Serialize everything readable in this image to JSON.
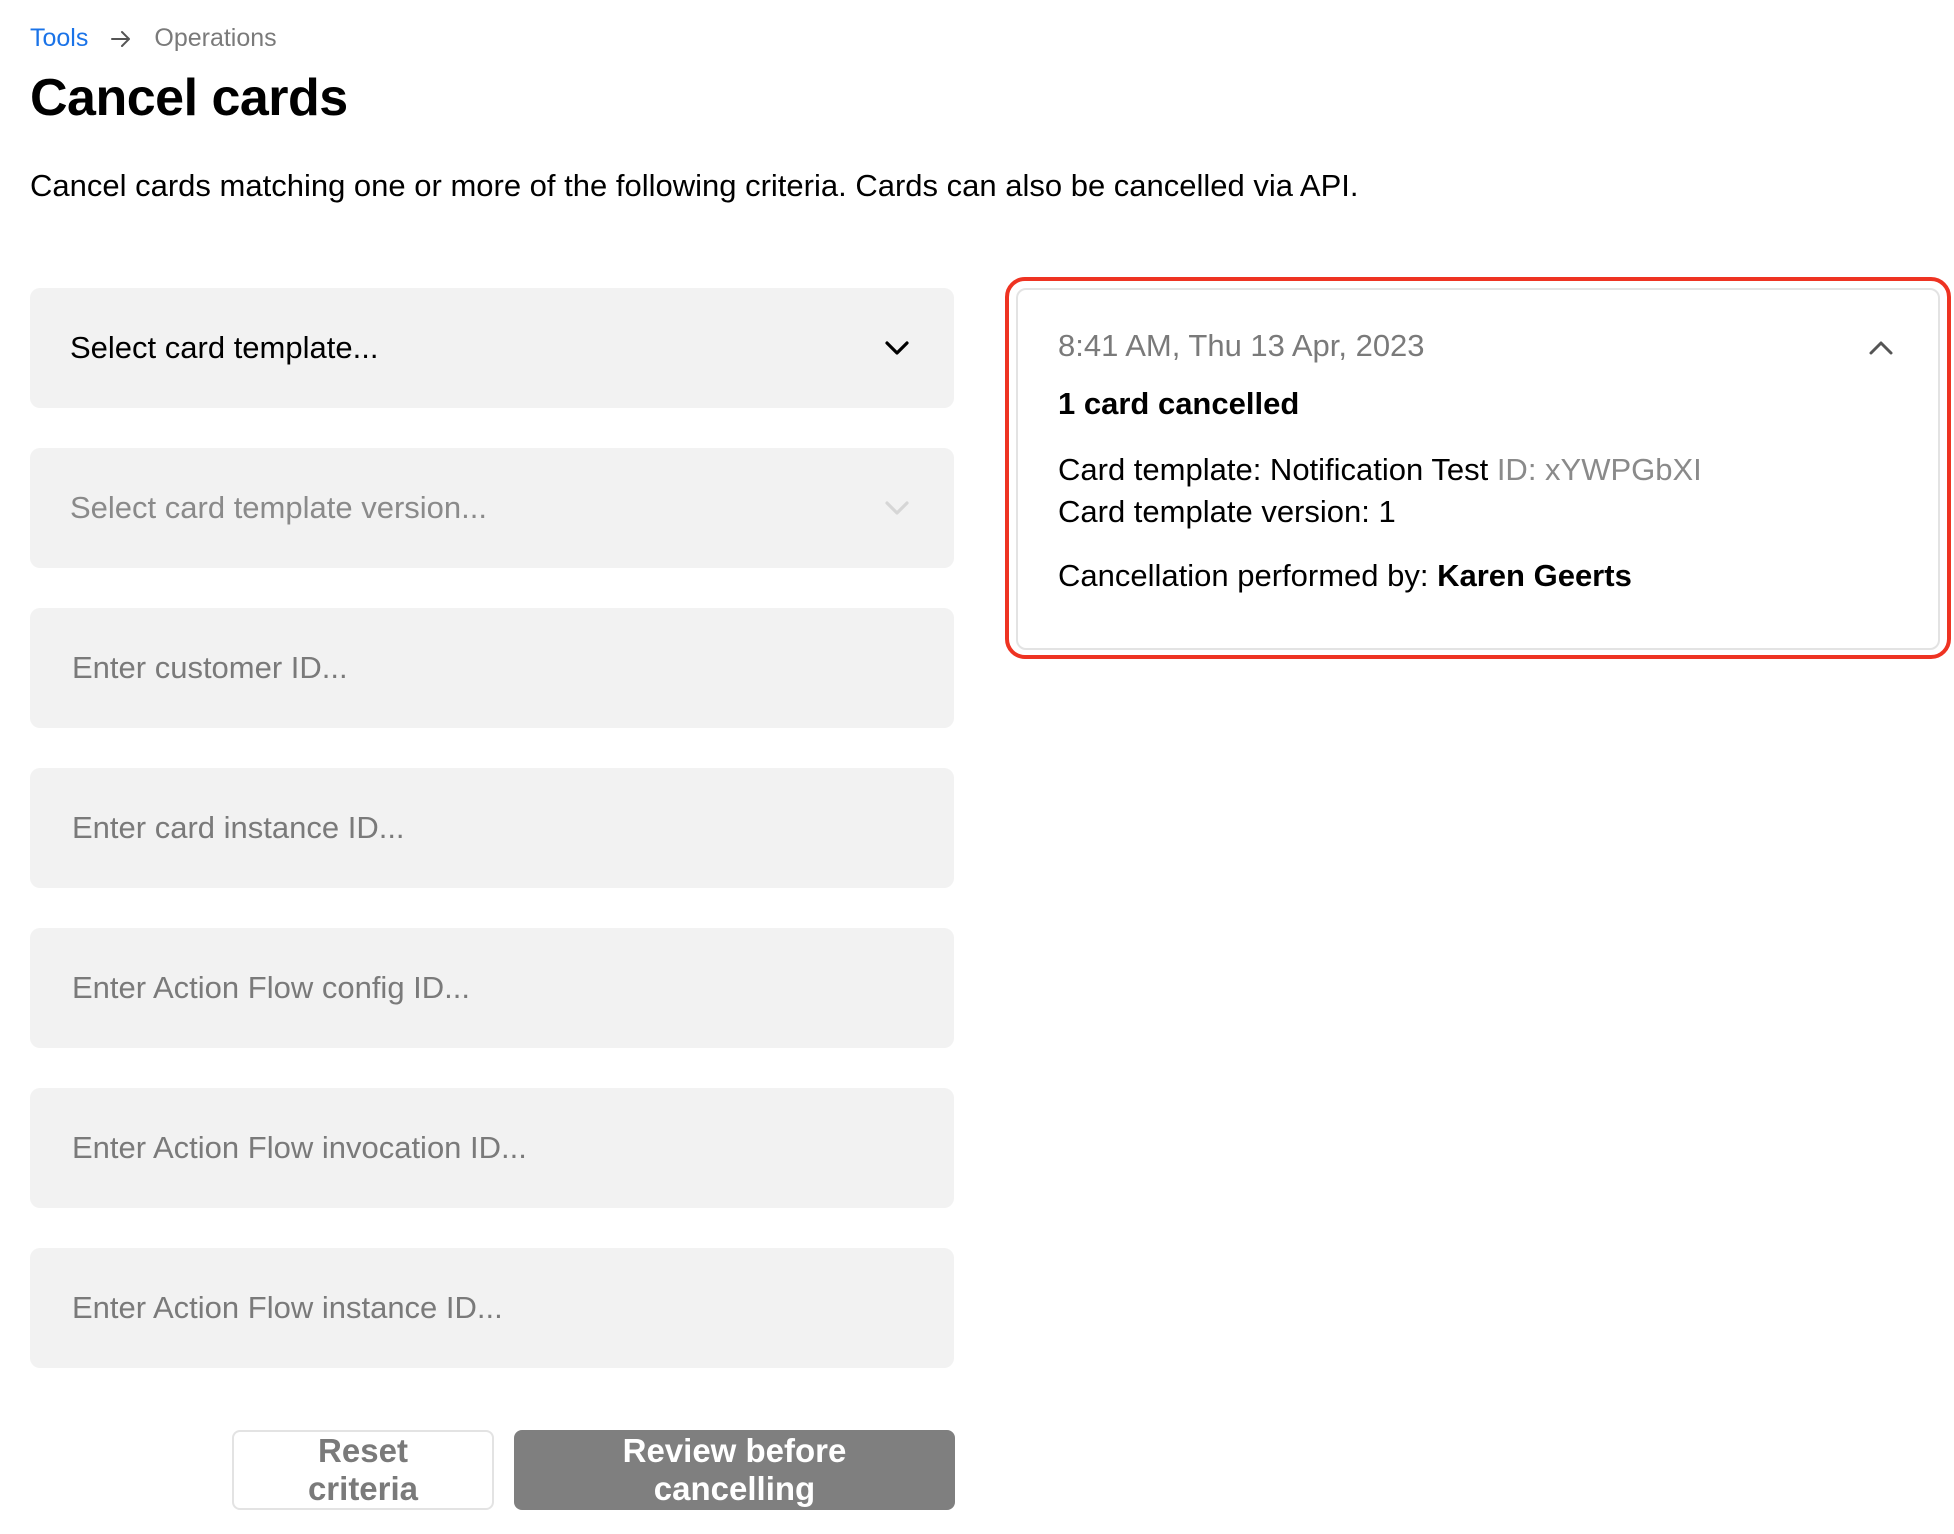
{
  "breadcrumb": {
    "parent": "Tools",
    "separator_icon": "arrow-right-icon",
    "current": "Operations"
  },
  "page": {
    "title": "Cancel cards",
    "description": "Cancel cards matching one or more of the following criteria. Cards can also be cancelled via API."
  },
  "form": {
    "card_template": {
      "placeholder": "Select card template...",
      "value": "",
      "icon": "chevron-down-icon"
    },
    "card_template_version": {
      "placeholder": "Select card template version...",
      "value": "",
      "disabled": true,
      "icon": "chevron-down-icon"
    },
    "customer_id": {
      "placeholder": "Enter customer ID...",
      "value": ""
    },
    "card_instance_id": {
      "placeholder": "Enter card instance ID...",
      "value": ""
    },
    "action_flow_config_id": {
      "placeholder": "Enter Action Flow config ID...",
      "value": ""
    },
    "action_flow_invocation_id": {
      "placeholder": "Enter Action Flow invocation ID...",
      "value": ""
    },
    "action_flow_instance_id": {
      "placeholder": "Enter Action Flow instance ID...",
      "value": ""
    }
  },
  "actions": {
    "reset_label": "Reset criteria",
    "review_label": "Review before cancelling"
  },
  "result": {
    "timestamp": "8:41 AM, Thu 13 Apr, 2023",
    "count_label": "1 card cancelled",
    "template_label": "Card template: Notification Test",
    "template_id": "ID: xYWPGbXI",
    "version_label": "Card template version: 1",
    "performed_by_label": "Cancellation performed by:",
    "performed_by_name": "Karen Geerts",
    "collapse_icon": "chevron-up-icon"
  },
  "colors": {
    "link": "#1a73e8",
    "highlight_border": "#ee3322",
    "field_bg": "#f2f2f2",
    "primary_button_bg": "#7f7f7f",
    "muted_text": "#7a7a7a"
  }
}
